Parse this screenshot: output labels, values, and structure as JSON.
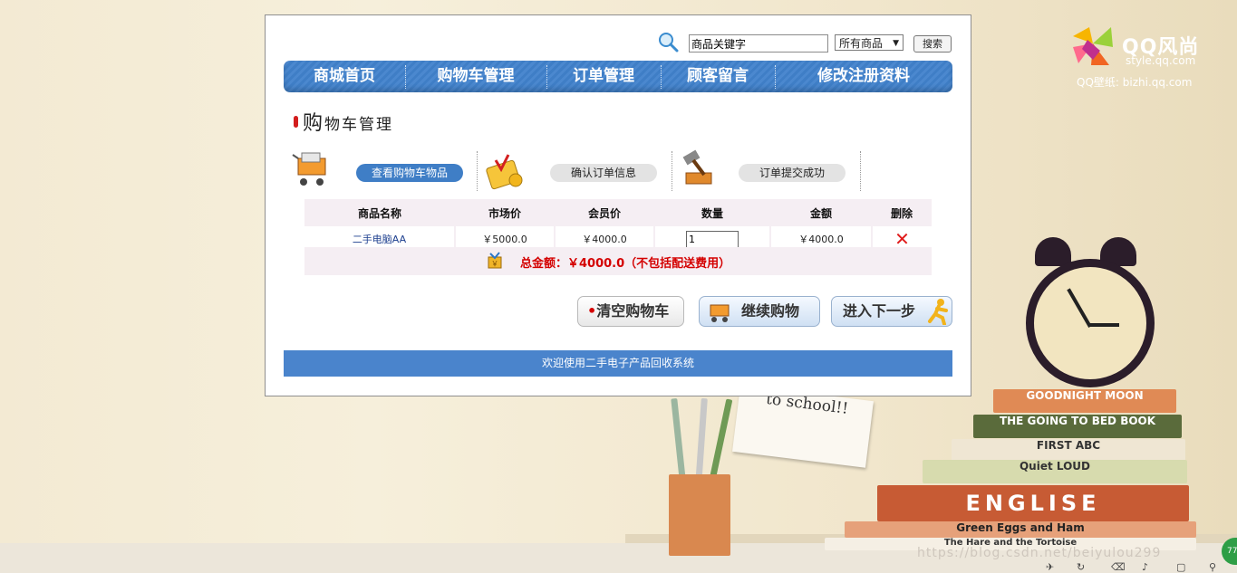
{
  "brand": {
    "name": "QQ风尚",
    "site": "style.qq.com",
    "sub": "QQ壁纸: bizhi.qq.com"
  },
  "search": {
    "value": "商品关键字",
    "category": "所有商品",
    "button": "搜索"
  },
  "nav": [
    "商城首页",
    "购物车管理",
    "订单管理",
    "顾客留言",
    "修改注册资料"
  ],
  "section": {
    "title_first": "购",
    "title_rest": "物车管理"
  },
  "steps": [
    {
      "label": "查看购物车物品",
      "icon": "cart-icon",
      "active": true
    },
    {
      "label": "确认订单信息",
      "icon": "calculator-icon",
      "active": false
    },
    {
      "label": "订单提交成功",
      "icon": "hammer-icon",
      "active": false
    }
  ],
  "table": {
    "headers": [
      "商品名称",
      "市场价",
      "会员价",
      "数量",
      "金额",
      "删除"
    ],
    "rows": [
      {
        "name": "二手电脑AA",
        "market_price": "￥5000.0",
        "member_price": "￥4000.0",
        "quantity": "1",
        "amount": "￥4000.0"
      }
    ]
  },
  "total": "总金额：￥4000.0（不包括配送费用）",
  "actions": {
    "clear": "清空购物车",
    "continue": "继续购物",
    "next": "进入下一步"
  },
  "footer": "欢迎使用二手电子产品回收系统",
  "decor": {
    "note": "to school!!",
    "books": [
      "GOODNIGHT MOON",
      "THE GOING TO BED BOOK",
      "FIRST ABC",
      "Quiet LOUD",
      "ENGLISE",
      "Green Eggs and Ham",
      "The Hare and the Tortoise"
    ],
    "watermark": "https://blog.csdn.net/beiyulou299",
    "badge": "77"
  },
  "colors": {
    "nav": "#4a84cc",
    "accent_red": "#d40000",
    "pill_active": "#3f7ec6"
  }
}
